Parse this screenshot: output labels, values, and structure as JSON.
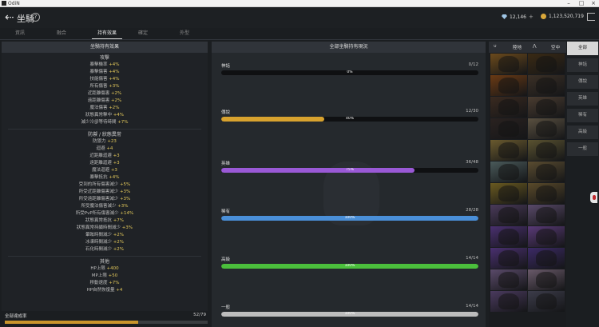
{
  "window": {
    "title": "OdiN"
  },
  "header": {
    "title": "坐騎",
    "gems": "12,146",
    "gold": "1,123,520,719"
  },
  "tabs": [
    {
      "label": "資訊",
      "active": false
    },
    {
      "label": "融合",
      "active": false
    },
    {
      "label": "持有效果",
      "active": true
    },
    {
      "label": "確定",
      "active": false
    },
    {
      "label": "外型",
      "active": false
    }
  ],
  "left": {
    "title": "坐騎持有效果",
    "sections": [
      {
        "title": "攻擊",
        "stats": [
          {
            "name": "暴擊機率",
            "value": "+4%"
          },
          {
            "name": "暴擊傷害",
            "value": "+4%"
          },
          {
            "name": "技能傷害",
            "value": "+4%"
          },
          {
            "name": "所有傷害",
            "value": "+3%"
          },
          {
            "name": "近距離傷害",
            "value": "+2%"
          },
          {
            "name": "遠距離傷害",
            "value": "+2%"
          },
          {
            "name": "魔法傷害",
            "value": "+2%"
          },
          {
            "name": "狀態異常擊中",
            "value": "+4%"
          },
          {
            "name": "減少冷卻等待時間",
            "value": "+7%"
          }
        ]
      },
      {
        "title": "防禦 / 狀態異常",
        "stats": [
          {
            "name": "防禦力",
            "value": "+23"
          },
          {
            "name": "迴避",
            "value": "+4"
          },
          {
            "name": "近距離迴避",
            "value": "+3"
          },
          {
            "name": "遠距離迴避",
            "value": "+3"
          },
          {
            "name": "魔法迴避",
            "value": "+3"
          },
          {
            "name": "暴擊抵抗",
            "value": "+4%"
          },
          {
            "name": "受到的所有傷害減少",
            "value": "+5%"
          },
          {
            "name": "所受近距離傷害減少",
            "value": "+3%"
          },
          {
            "name": "所受遠距離傷害減少",
            "value": "+3%"
          },
          {
            "name": "所受魔法傷害減少",
            "value": "+3%"
          },
          {
            "name": "所受PvP所有傷害減少",
            "value": "+14%"
          },
          {
            "name": "狀態異常抵抗",
            "value": "+7%"
          },
          {
            "name": "狀態異常持續時間減少",
            "value": "+3%"
          },
          {
            "name": "暈眩時間減少",
            "value": "+2%"
          },
          {
            "name": "冰凍時間減少",
            "value": "+2%"
          },
          {
            "name": "石化時間減少",
            "value": "+2%"
          }
        ]
      },
      {
        "title": "其他",
        "stats": [
          {
            "name": "HP上限",
            "value": "+400"
          },
          {
            "name": "MP上限",
            "value": "+50"
          },
          {
            "name": "移動速度",
            "value": "+7%"
          },
          {
            "name": "HP自然恢復量",
            "value": "+4"
          }
        ]
      }
    ],
    "overall": {
      "label": "全部達成率",
      "count": "52/79",
      "progress": 0.658
    }
  },
  "middle": {
    "title": "全部坐騎持有現況",
    "grades": [
      {
        "name": "神話",
        "count": "0/12",
        "percent": "0%",
        "progress": 0,
        "color": "#8a8a8a"
      },
      {
        "name": "傳說",
        "count": "12/30",
        "percent": "40%",
        "progress": 0.4,
        "color": "#d8a22e"
      },
      {
        "name": "英雄",
        "count": "36/48",
        "percent": "75%",
        "progress": 0.75,
        "color": "#9a59d6"
      },
      {
        "name": "稀有",
        "count": "28/28",
        "percent": "100%",
        "progress": 1.0,
        "color": "#4a8fd8"
      },
      {
        "name": "高級",
        "count": "14/14",
        "percent": "100%",
        "progress": 1.0,
        "color": "#4bbf3c"
      },
      {
        "name": "一般",
        "count": "14/14",
        "percent": "100%",
        "progress": 1.0,
        "color": "#bdbdbd"
      }
    ]
  },
  "grid": {
    "ground_label": "陸地",
    "air_label": "空中",
    "cell_colors": [
      "#6b4a1c",
      "#3a2a14",
      "#6a3a14",
      "#3b3026",
      "#3a2a20",
      "#4a3c30",
      "#2a2220",
      "#5a5040",
      "#6a5a2e",
      "#5a5230",
      "#4a5a5a",
      "#5a4c30",
      "#6a5a20",
      "#5a4a2a",
      "#4a3a5a",
      "#5a4a6a",
      "#4a3070",
      "#5a3a78",
      "#4a3070",
      "#3c2a66",
      "#5a4a6a",
      "#6a5a6a",
      "#4a3a5e",
      "#3c3c4a"
    ]
  },
  "filters": [
    {
      "label": "全部",
      "active": true
    },
    {
      "label": "神話",
      "active": false
    },
    {
      "label": "傳說",
      "active": false
    },
    {
      "label": "英雄",
      "active": false
    },
    {
      "label": "稀有",
      "active": false
    },
    {
      "label": "高級",
      "active": false
    },
    {
      "label": "一般",
      "active": false
    }
  ]
}
